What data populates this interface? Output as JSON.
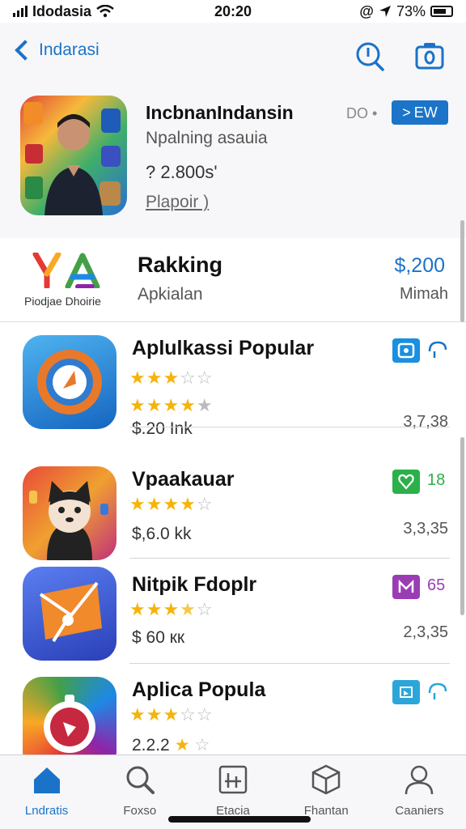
{
  "status_bar": {
    "carrier": "Idodasia",
    "time": "20:20",
    "battery": "73%"
  },
  "nav": {
    "back_label": "Indarasi"
  },
  "hero": {
    "title": "IncbnanIndansin",
    "subtitle": "Npalning asauia",
    "count": "? 2.800s'",
    "link": "Plapoir )",
    "dots": "DO •",
    "badge": "EW"
  },
  "ranking": {
    "logo_label": "Piodjae Dhoirie",
    "title": "Rakking",
    "subtitle": "Apkialan",
    "price": "$,200",
    "meta": "Mimah"
  },
  "apps": [
    {
      "title": "Aplulkassi Popular",
      "rating_stars": 3,
      "rating_stars_2": 4,
      "price": "$.20 Ink",
      "meta": "3,7,38",
      "badge_color": "#1b8fe0",
      "tag": "",
      "tag_color": "#1b74c8"
    },
    {
      "title": "Vpaakauar",
      "rating_stars": 4,
      "price": "$,6.0 kk",
      "meta": "3,3,35",
      "badge_color": "#2bb04a",
      "tag": "18",
      "tag_color": "#2bb04a"
    },
    {
      "title": "Nitpik Fdoplr",
      "rating_stars": 3.5,
      "price": "$ 60 кк",
      "meta": "2,3,35",
      "badge_color": "#9a3db5",
      "tag": "65",
      "tag_color": "#9a3db5"
    },
    {
      "title": "Aplica Popula",
      "rating_stars": 3,
      "price": "2.2.2",
      "meta": "",
      "badge_color": "#2aa7d8",
      "tag": "",
      "tag_color": "#2aa7d8"
    }
  ],
  "tabs": [
    {
      "label": "Lndratis",
      "icon": "home-icon",
      "active": true
    },
    {
      "label": "Foxso",
      "icon": "search-icon",
      "active": false
    },
    {
      "label": "Etacia",
      "icon": "chart-icon",
      "active": false
    },
    {
      "label": "Fhantan",
      "icon": "box-icon",
      "active": false
    },
    {
      "label": "Caaniers",
      "icon": "person-icon",
      "active": false
    }
  ]
}
